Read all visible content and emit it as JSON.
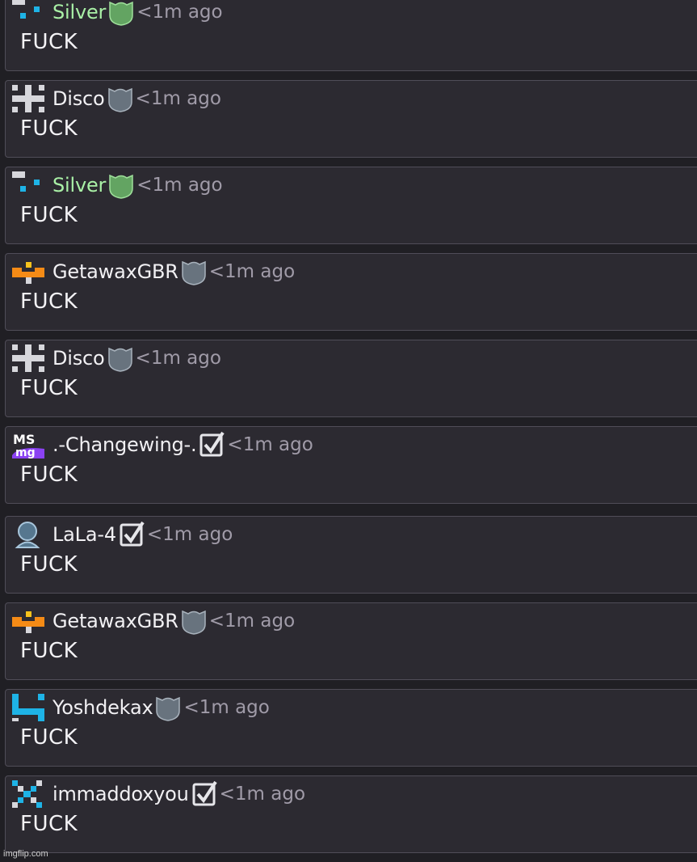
{
  "comments": [
    {
      "username": "Silver",
      "avatar_icon": "silver-avatar-icon",
      "badge_icon": "shield-green-icon",
      "time": "<1m ago",
      "text": "FUCK",
      "name_color": "#a9f0a6"
    },
    {
      "username": "Disco",
      "avatar_icon": "disco-avatar-icon",
      "badge_icon": "shield-gray-icon",
      "time": "<1m ago",
      "text": "FUCK"
    },
    {
      "username": "Silver",
      "avatar_icon": "silver-avatar-icon",
      "badge_icon": "shield-green-icon",
      "time": "<1m ago",
      "text": "FUCK",
      "name_color": "#a9f0a6"
    },
    {
      "username": "GetawaxGBR",
      "avatar_icon": "getawax-avatar-icon",
      "badge_icon": "shield-gray-icon",
      "time": "<1m ago",
      "text": "FUCK"
    },
    {
      "username": "Disco",
      "avatar_icon": "disco-avatar-icon",
      "badge_icon": "shield-gray-icon",
      "time": "<1m ago",
      "text": "FUCK"
    },
    {
      "username": ".-Changewing-.",
      "avatar_icon": "msmg-logo-avatar-icon",
      "avatar_text": [
        "MS",
        "mg"
      ],
      "badge_icon": "checkbox-icon",
      "time": "<1m ago",
      "text": "FUCK"
    },
    {
      "username": "LaLa-4",
      "avatar_icon": "default-user-avatar-icon",
      "badge_icon": "checkbox-icon",
      "time": "<1m ago",
      "text": "FUCK"
    },
    {
      "username": "GetawaxGBR",
      "avatar_icon": "getawax-avatar-icon",
      "badge_icon": "shield-gray-icon",
      "time": "<1m ago",
      "text": "FUCK"
    },
    {
      "username": "Yoshdekax",
      "avatar_icon": "yoshdekax-avatar-icon",
      "badge_icon": "shield-gray-icon",
      "time": "<1m ago",
      "text": "FUCK"
    },
    {
      "username": "immaddoxyou",
      "avatar_icon": "immaddoxyou-avatar-icon",
      "badge_icon": "checkbox-icon",
      "time": "<1m ago",
      "text": "FUCK"
    }
  ],
  "watermark": "imgflip.com",
  "colors": {
    "background": "#201f24",
    "card": "#2c2a31",
    "border": "#504d58",
    "text": "#f4f3f6",
    "time": "#a09ba8",
    "silver_name": "#a9f0a6",
    "shield_green": "#63a462",
    "shield_gray": "#68737e",
    "avatar_cyan": "#1eb3e6",
    "avatar_orange": "#f58b16",
    "avatar_purple": "#8b42f2"
  }
}
